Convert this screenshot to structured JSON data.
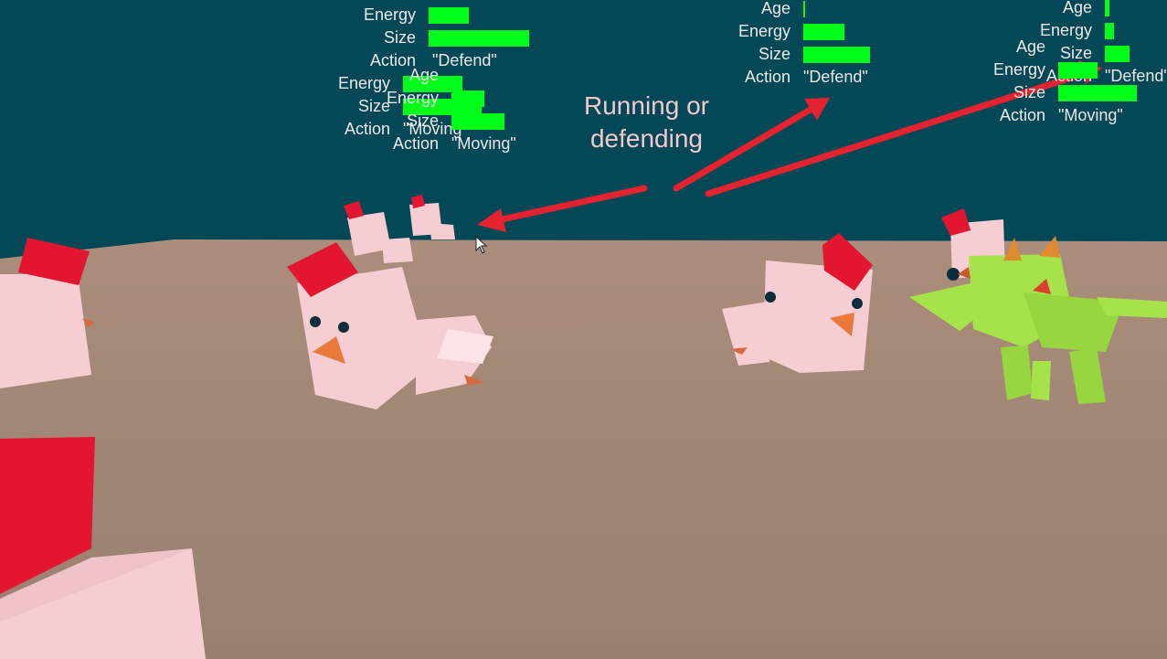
{
  "hud_labels": {
    "age": "Age",
    "energy": "Energy",
    "size": "Size",
    "action": "Action"
  },
  "annotation": {
    "line1": "Running or",
    "line2": "defending",
    "arrow_color": "#e5222f"
  },
  "colors": {
    "sky": "#034856",
    "ground": "#a88b79",
    "bar": "#00ff18",
    "chicken_body": "#f5cdd3",
    "chicken_comb": "#e21631",
    "dragon": "#a6e34a"
  },
  "stat_panels": [
    {
      "age": 0.02,
      "energy": 0.4,
      "size": 1.0,
      "action": "\"Defend\""
    },
    {
      "age": 0.02,
      "energy": 0.72,
      "size": 0.95,
      "action": "\"Moving\""
    },
    {
      "age": 0.02,
      "energy": 0.45,
      "size": 0.73,
      "action": "\"Moving\""
    },
    {
      "age": 0.02,
      "energy": 0.45,
      "size": 0.73,
      "action": "\"Defend\""
    },
    {
      "age": 0.05,
      "energy": 0.1,
      "size": 0.28,
      "action": "\"Defend\""
    },
    {
      "age": 0.02,
      "energy": 0.45,
      "size": 0.9,
      "action": "\"Moving\""
    }
  ]
}
